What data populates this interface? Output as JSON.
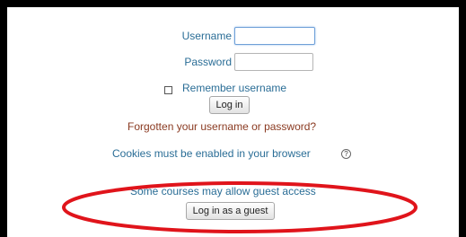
{
  "login": {
    "username_label": "Username",
    "username_value": "",
    "password_label": "Password",
    "password_value": "",
    "remember_label": "Remember username",
    "remember_checked": false,
    "login_button": "Log in",
    "forgot_link": "Forgotten your username or password?",
    "cookies_notice": "Cookies must be enabled in your browser",
    "help_icon": "question-circle-icon"
  },
  "guest": {
    "notice": "Some courses may allow guest access",
    "button": "Log in as a guest"
  },
  "colors": {
    "label_blue": "#2a6d96",
    "link_brown": "#8a3a21",
    "annotation_red": "#e0141b"
  }
}
